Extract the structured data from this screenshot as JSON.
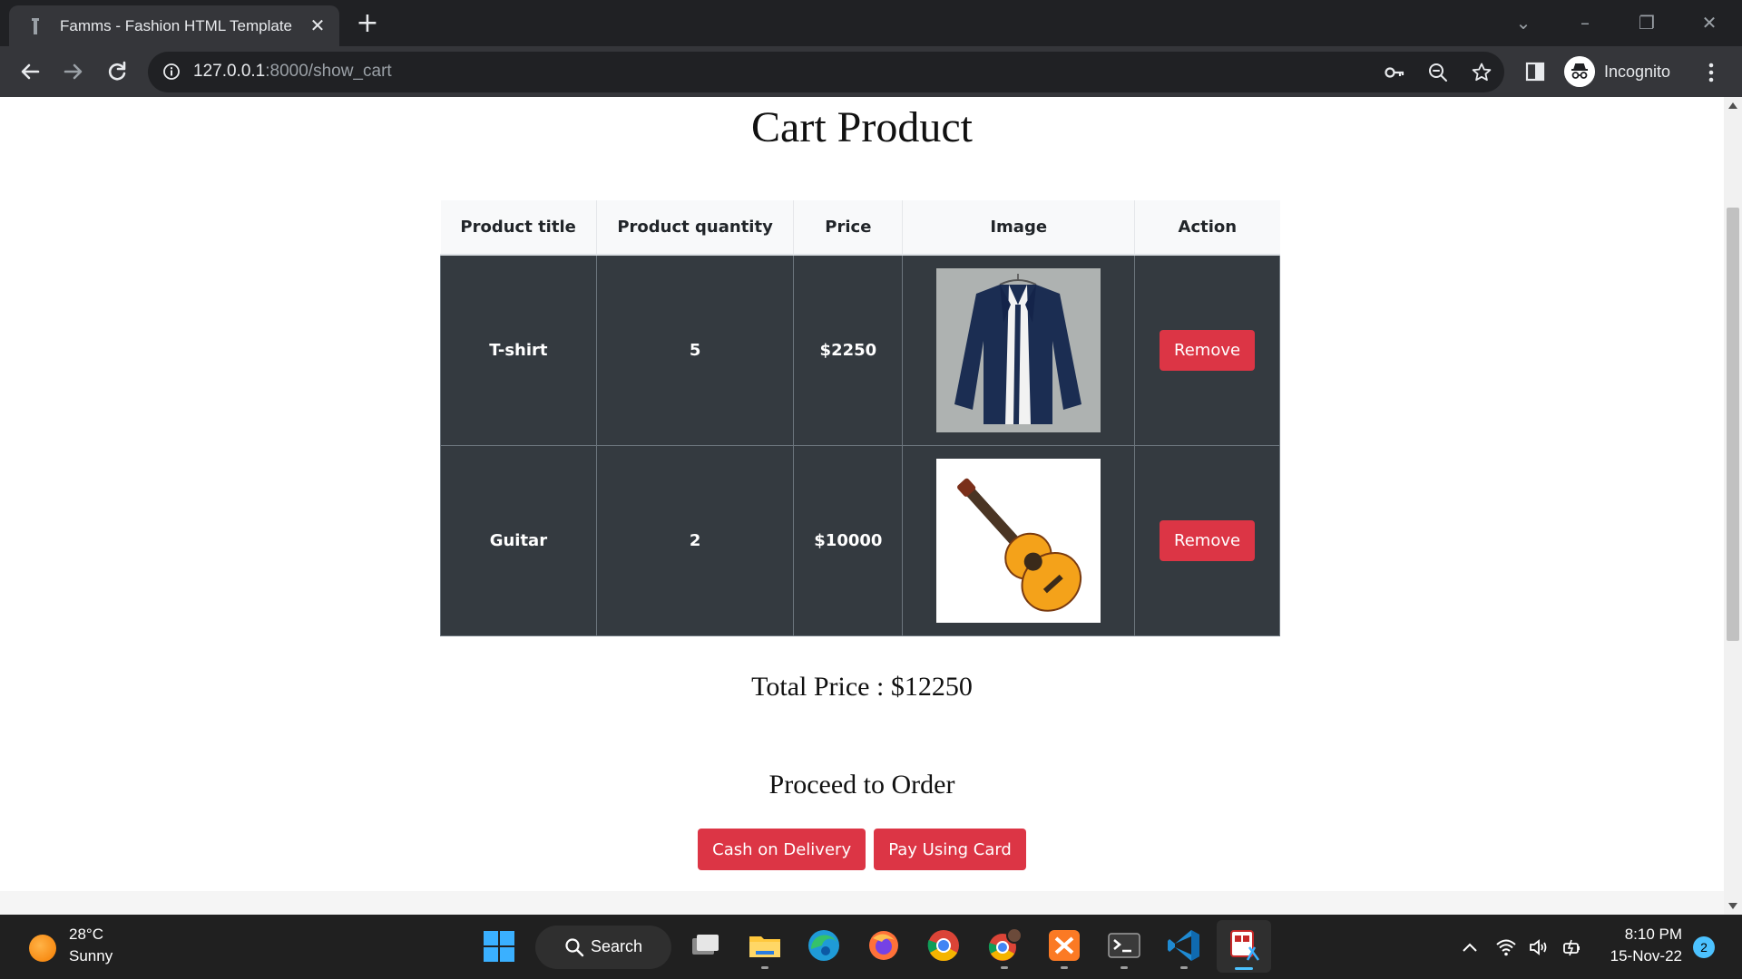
{
  "browser": {
    "tab_title": "Famms - Fashion HTML Template",
    "url_host": "127.0.0.1",
    "url_rest": ":8000/show_cart",
    "profile_label": "Incognito"
  },
  "page": {
    "title": "Cart Product",
    "table": {
      "headers": [
        "Product title",
        "Product quantity",
        "Price",
        "Image",
        "Action"
      ],
      "rows": [
        {
          "title": "T-shirt",
          "quantity": "5",
          "price": "$2250",
          "image_icon": "shirt-image",
          "action": "Remove"
        },
        {
          "title": "Guitar",
          "quantity": "2",
          "price": "$10000",
          "image_icon": "guitar-image",
          "action": "Remove"
        }
      ]
    },
    "total_price": "Total Price : $12250",
    "proceed_heading": "Proceed to Order",
    "cash_button": "Cash on Delivery",
    "card_button": "Pay Using Card"
  },
  "colors": {
    "accent_red": "#dc3545",
    "table_dark": "#343a40",
    "chrome_dark": "#202124",
    "taskbar": "#202020"
  },
  "taskbar": {
    "weather_temp": "28°C",
    "weather_condition": "Sunny",
    "search_label": "Search",
    "time": "8:10 PM",
    "date": "15-Nov-22",
    "notification_count": "2"
  }
}
